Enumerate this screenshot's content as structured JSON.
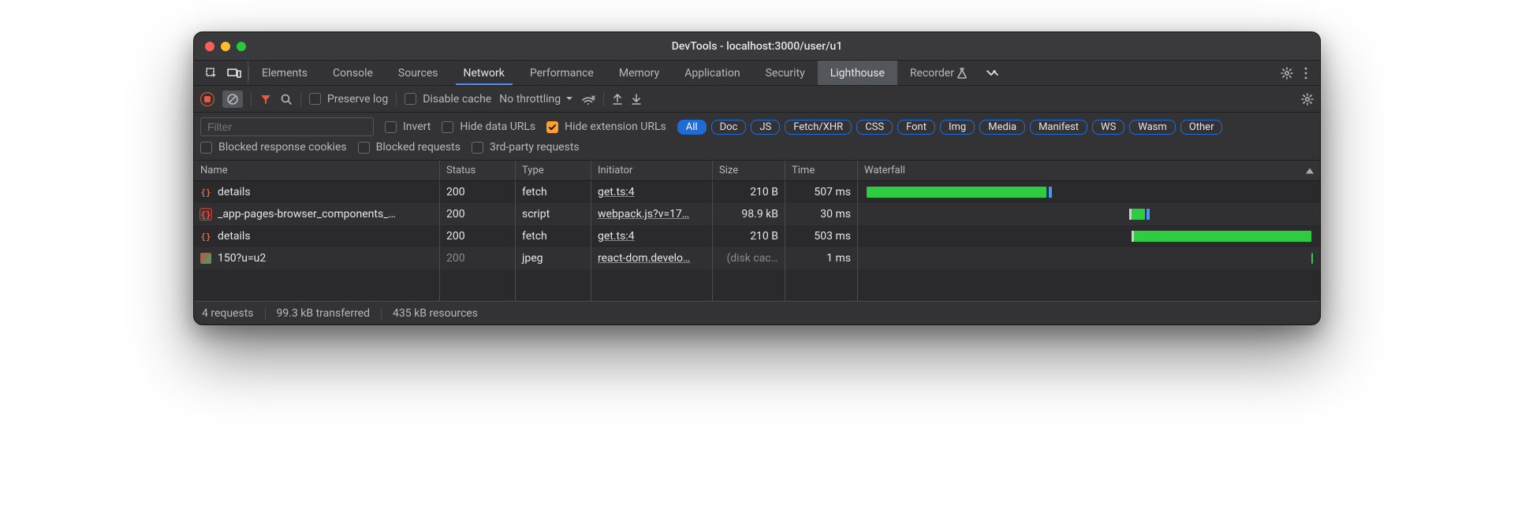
{
  "window": {
    "title": "DevTools - localhost:3000/user/u1"
  },
  "tabs": {
    "items": [
      "Elements",
      "Console",
      "Sources",
      "Network",
      "Performance",
      "Memory",
      "Application",
      "Security",
      "Lighthouse",
      "Recorder"
    ],
    "active": "Network",
    "highlighted": "Lighthouse"
  },
  "toolbar": {
    "preserve_log": "Preserve log",
    "disable_cache": "Disable cache",
    "throttling": "No throttling"
  },
  "filter": {
    "placeholder": "Filter",
    "invert": "Invert",
    "hide_data_urls": "Hide data URLs",
    "hide_ext_urls": "Hide extension URLs",
    "pills": [
      "All",
      "Doc",
      "JS",
      "Fetch/XHR",
      "CSS",
      "Font",
      "Img",
      "Media",
      "Manifest",
      "WS",
      "Wasm",
      "Other"
    ],
    "active_pill": "All",
    "blocked_cookies": "Blocked response cookies",
    "blocked_requests": "Blocked requests",
    "third_party": "3rd-party requests"
  },
  "columns": {
    "name": "Name",
    "status": "Status",
    "type": "Type",
    "initiator": "Initiator",
    "size": "Size",
    "time": "Time",
    "waterfall": "Waterfall"
  },
  "rows": [
    {
      "icon": "braces",
      "name": "details",
      "status": "200",
      "status_muted": false,
      "type": "fetch",
      "initiator": "get.ts:4",
      "size": "210 B",
      "time": "507 ms",
      "wf": {
        "start": 0.5,
        "len": 40,
        "ttfb_at": 41,
        "post_wait": false
      }
    },
    {
      "icon": "braces-red",
      "name": "_app-pages-browser_components_…",
      "status": "200",
      "status_muted": false,
      "type": "script",
      "initiator": "webpack.js?v=17…",
      "size": "98.9 kB",
      "time": "30 ms",
      "wf": {
        "start": 59.5,
        "len": 3,
        "ttfb_at": 62.8,
        "pre_wait": 59,
        "small": true
      }
    },
    {
      "icon": "braces",
      "name": "details",
      "status": "200",
      "status_muted": false,
      "type": "fetch",
      "initiator": "get.ts:4",
      "size": "210 B",
      "time": "503 ms",
      "wf": {
        "start": 60,
        "len": 39.5,
        "pre_wait": 59.5
      }
    },
    {
      "icon": "image",
      "name": "150?u=u2",
      "status": "200",
      "status_muted": true,
      "type": "jpeg",
      "initiator": "react-dom.develo…",
      "size": "(disk cac…",
      "time": "1 ms",
      "wf": {
        "start": 99.5,
        "len": 0.4,
        "tiny": true
      }
    }
  ],
  "status": {
    "requests": "4 requests",
    "transferred": "99.3 kB transferred",
    "resources": "435 kB resources"
  }
}
